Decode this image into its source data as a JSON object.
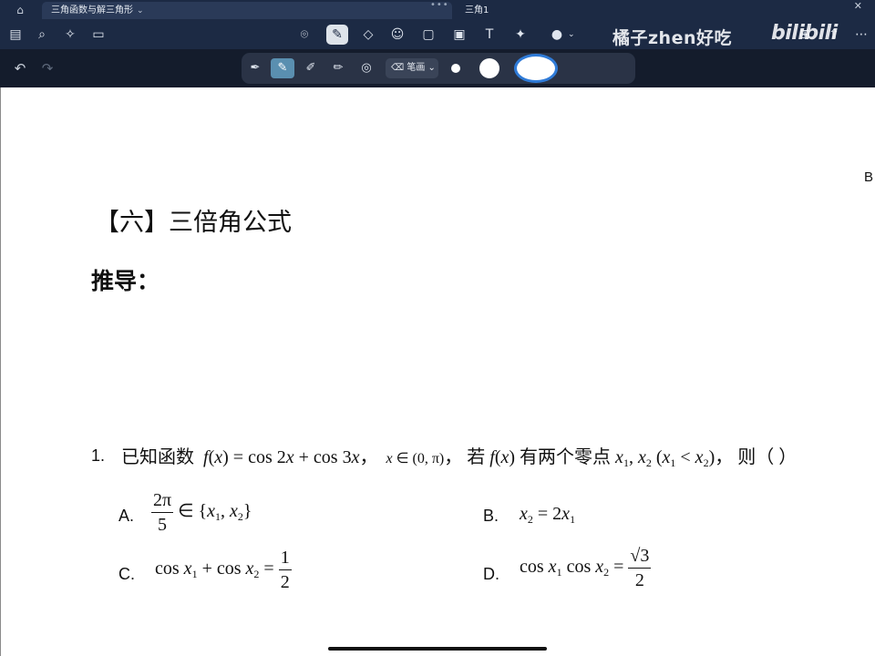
{
  "tabs": [
    {
      "label": "三角函数与解三角形",
      "active": true
    },
    {
      "label": "三角1",
      "active": false
    }
  ],
  "toolbar": {
    "left_icons": [
      "sidebar-icon",
      "search-icon",
      "magic-icon",
      "document-icon"
    ],
    "center_icons": [
      "lasso-icon",
      "pen-icon",
      "shapes-icon",
      "sticker-icon",
      "note-icon",
      "image-icon",
      "text-box-icon",
      "laser-icon",
      "microphone-icon"
    ],
    "right_icons": [
      "add-page-icon",
      "share-icon",
      "more-icon"
    ]
  },
  "overlay": {
    "watermark_text": "橘子zhen好吃",
    "logo_text": "bilibili"
  },
  "pen_toolbar": {
    "tools": [
      "fountain-pen-icon",
      "highlighter-icon",
      "brush-icon",
      "pencil-icon",
      "shape-pen-icon"
    ],
    "active_tool": "highlighter-icon",
    "stroke_label": "笔画",
    "selected_color": "#ffffff",
    "accent_color": "#2f7bd8"
  },
  "document": {
    "heading": "【六】三倍角公式",
    "derivation_label": "推导：",
    "edge_letter": "B",
    "question": {
      "number": "1.",
      "stem_prefix": "已知函数",
      "function_def": "f(x) = cos 2x + cos 3x",
      "domain": "x ∈ (0, π)",
      "stem_middle": "若",
      "fx": "f(x)",
      "stem_zero": "有两个零点",
      "zeros": "x1, x2 (x1 < x2)",
      "stem_end": "则（    ）"
    },
    "options": [
      {
        "label": "A.",
        "num": "2π",
        "den": "5",
        "rest": "∈ {x1, x2}"
      },
      {
        "label": "B.",
        "expr": "x2 = 2x1"
      },
      {
        "label": "C.",
        "expr": "cos x1 + cos x2 =",
        "num": "1",
        "den": "2"
      },
      {
        "label": "D.",
        "expr": "cos x1 cos x2 =",
        "num": "√3",
        "den": "2"
      }
    ]
  }
}
